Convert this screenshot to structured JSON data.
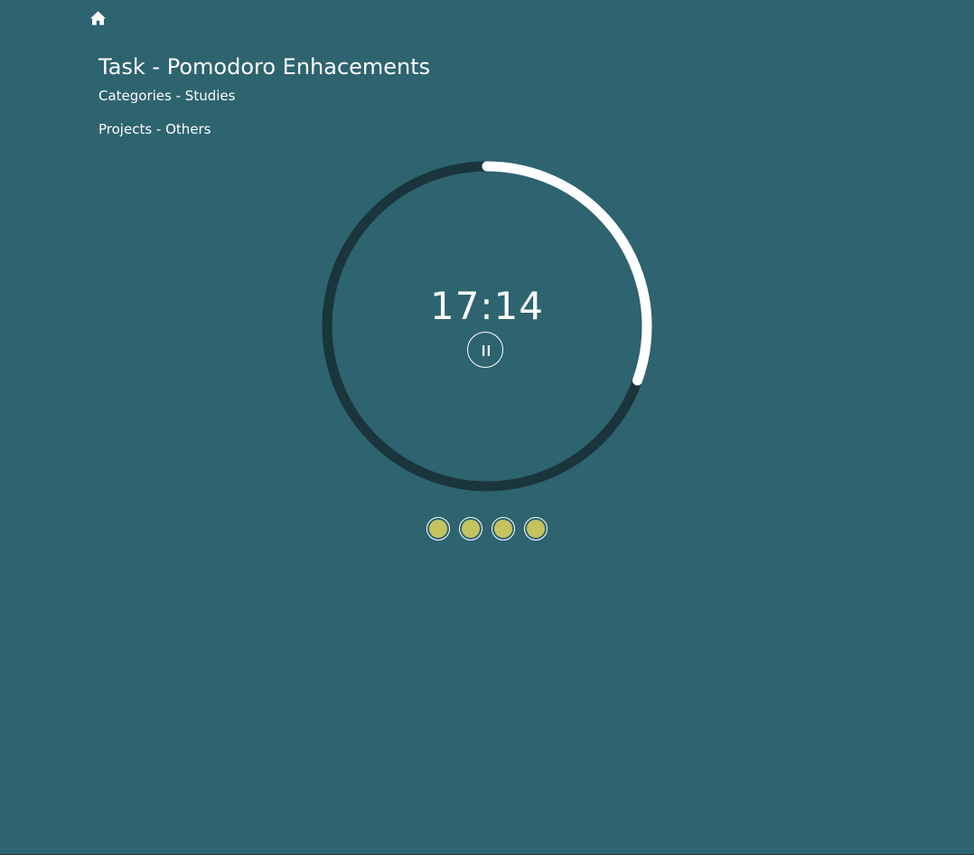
{
  "colors": {
    "background": "#2e6370",
    "ring_track": "#1a353c",
    "ring_progress": "#ffffff",
    "text": "#ffffff",
    "session_dot_fill": "#c4c35e"
  },
  "nav": {
    "home_icon": "home-icon"
  },
  "task": {
    "title": "Task - Pomodoro Enhacements",
    "categories": "Categories - Studies",
    "projects": "Projects - Others"
  },
  "timer": {
    "display": "17:14",
    "remaining_fraction": 0.305,
    "state": "running",
    "control_icon": "pause-icon"
  },
  "sessions": {
    "total": 4,
    "completed": 4
  }
}
